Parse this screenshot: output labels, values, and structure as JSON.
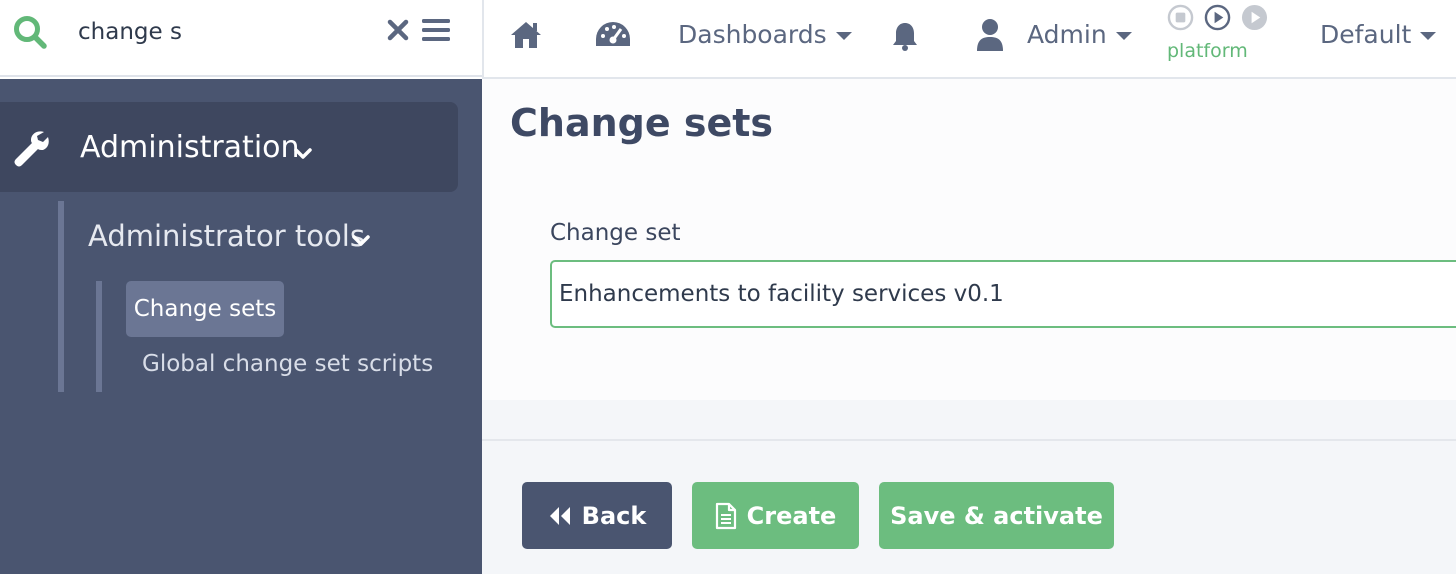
{
  "search": {
    "value": "change s"
  },
  "navbar": {
    "dashboards_label": "Dashboards",
    "user_label": "Admin",
    "platform_label": "platform",
    "default_label": "Default"
  },
  "sidebar": {
    "section_label": "Administration",
    "group_label": "Administrator tools",
    "items": [
      {
        "label": "Change sets",
        "active": true
      },
      {
        "label": "Global change set scripts",
        "active": false
      }
    ]
  },
  "main": {
    "title": "Change sets",
    "field_label": "Change set",
    "field_value": "Enhancements to facility services v0.1"
  },
  "buttons": {
    "back_label": "Back",
    "create_label": "Create",
    "save_label": "Save & activate"
  },
  "colors": {
    "accent_green": "#6cbd7f",
    "sidebar_bg": "#4a5570",
    "title_text": "#3e4964"
  },
  "icons": [
    "search-icon",
    "clear-icon",
    "menu-icon",
    "home-icon",
    "dashboard-gauge-icon",
    "bell-icon",
    "user-icon",
    "stop-icon",
    "play-icon",
    "wrench-icon",
    "chevron-down-icon",
    "rewind-icon",
    "document-icon"
  ]
}
